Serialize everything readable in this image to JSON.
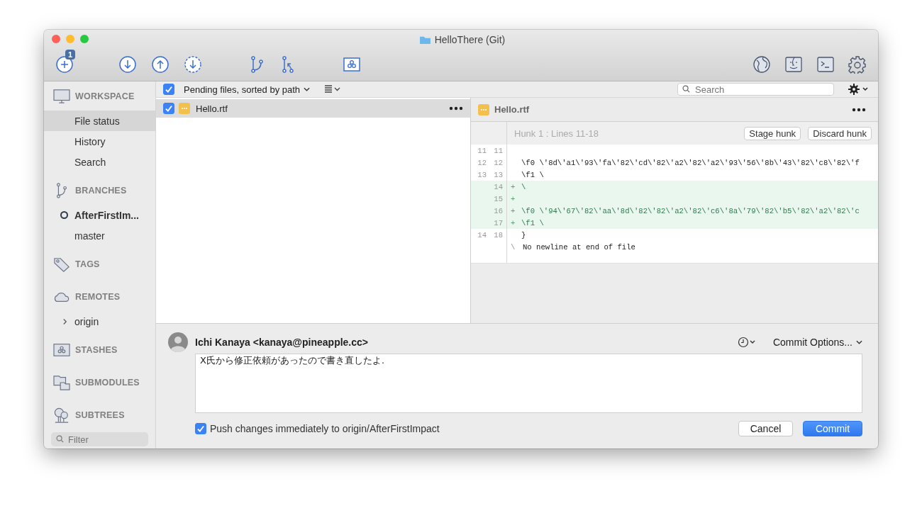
{
  "window": {
    "title": "HelloThere (Git)"
  },
  "toolbar": {
    "badge": "1"
  },
  "sidebar": {
    "sections": [
      {
        "kind": "workspace",
        "heading": "WORKSPACE",
        "items": [
          {
            "label": "File status",
            "selected": true
          },
          {
            "label": "History",
            "selected": false
          },
          {
            "label": "Search",
            "selected": false
          }
        ]
      },
      {
        "kind": "branches",
        "heading": "BRANCHES",
        "items": [
          {
            "label": "AfterFirstIm...",
            "selected": false,
            "current": true
          },
          {
            "label": "master",
            "selected": false,
            "current": false
          }
        ]
      },
      {
        "kind": "tags",
        "heading": "TAGS"
      },
      {
        "kind": "remotes",
        "heading": "REMOTES",
        "items": [
          {
            "label": "origin",
            "selected": false,
            "expanded": false
          }
        ]
      },
      {
        "kind": "stashes",
        "heading": "STASHES"
      },
      {
        "kind": "submodules",
        "heading": "SUBMODULES"
      },
      {
        "kind": "subtrees",
        "heading": "SUBTREES"
      }
    ],
    "filter": {
      "placeholder": "Filter"
    }
  },
  "file_bar": {
    "checked": true,
    "label": "Pending files, sorted by path",
    "search": {
      "placeholder": "Search"
    }
  },
  "files": [
    {
      "name": "Hello.rtf",
      "checked": true,
      "selected": true
    }
  ],
  "diff": {
    "file": "Hello.rtf",
    "hunk": "Hunk 1 : Lines 11-18",
    "buttons": [
      "Stage hunk",
      "Discard hunk"
    ],
    "lines": [
      {
        "kind": "context",
        "old": "11",
        "new": "11"
      },
      {
        "kind": "context",
        "old": "12",
        "new": "12",
        "text": "\\f0 \\'8d\\'a1\\'93\\'fa\\'82\\'cd\\'82\\'a2\\'82\\'a2\\'93\\'56\\'8b\\'43\\'82\\'c8\\'82\\'f"
      },
      {
        "kind": "context",
        "old": "13",
        "new": "13",
        "text": "\\f1 \\"
      },
      {
        "kind": "added",
        "new": "14",
        "sign": "+",
        "text": "\\"
      },
      {
        "kind": "added",
        "new": "15",
        "sign": "+"
      },
      {
        "kind": "added",
        "new": "16",
        "sign": "+",
        "text": "\\f0 \\'94\\'67\\'82\\'aa\\'8d\\'82\\'82\\'a2\\'82\\'c6\\'8a\\'79\\'82\\'b5\\'82\\'a2\\'82\\'c"
      },
      {
        "kind": "added",
        "new": "17",
        "sign": "+",
        "text": "\\f1 \\"
      },
      {
        "kind": "context",
        "old": "14",
        "new": "18",
        "text": "}"
      },
      {
        "kind": "note",
        "sign": "\\",
        "text": "No newline at end of file"
      }
    ]
  },
  "commit": {
    "author": "Ichi Kanaya <kanaya@pineapple.cc>",
    "options": "Commit Options...",
    "message": "X氏から修正依頼があったので書き直したよ.",
    "push": {
      "checked": true,
      "label": "Push changes immediately to origin/AfterFirstImpact"
    },
    "buttons": [
      "Cancel",
      "Commit"
    ]
  }
}
